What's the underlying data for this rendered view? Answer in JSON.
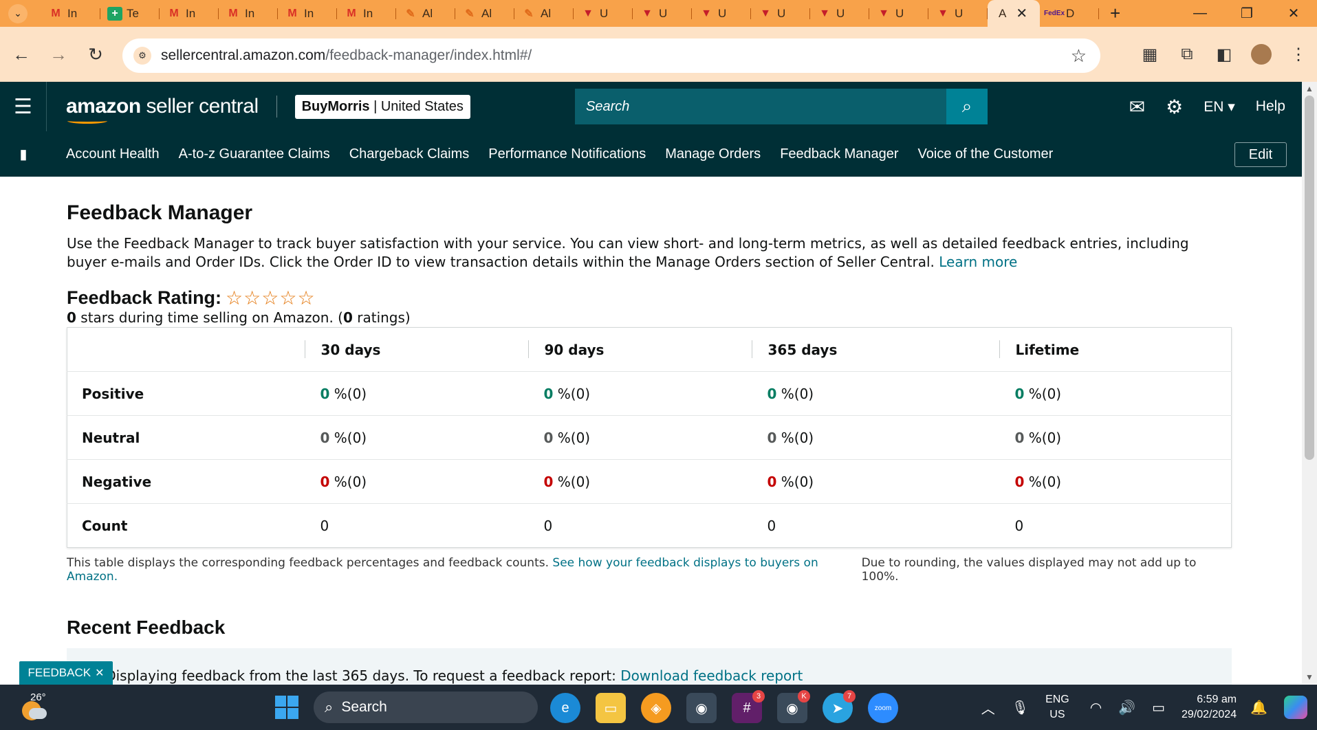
{
  "browser": {
    "tabs": [
      {
        "icon": "gmail-icon",
        "glyph": "M",
        "label": "In"
      },
      {
        "icon": "sheets-icon",
        "glyph": "+",
        "label": "Te"
      },
      {
        "icon": "gmail-icon",
        "glyph": "M",
        "label": "In"
      },
      {
        "icon": "gmail-icon",
        "glyph": "M",
        "label": "In"
      },
      {
        "icon": "gmail-icon",
        "glyph": "M",
        "label": "In"
      },
      {
        "icon": "gmail-icon",
        "glyph": "M",
        "label": "In"
      },
      {
        "icon": "pen-icon",
        "glyph": "✎",
        "label": "Al"
      },
      {
        "icon": "pen-icon",
        "glyph": "✎",
        "label": "Al"
      },
      {
        "icon": "pen-icon",
        "glyph": "✎",
        "label": "Al"
      },
      {
        "icon": "shield-v-icon",
        "glyph": "▼",
        "label": "U"
      },
      {
        "icon": "shield-v-icon",
        "glyph": "▼",
        "label": "U"
      },
      {
        "icon": "shield-v-icon",
        "glyph": "▼",
        "label": "U"
      },
      {
        "icon": "shield-v-icon",
        "glyph": "▼",
        "label": "U"
      },
      {
        "icon": "shield-v-icon",
        "glyph": "▼",
        "label": "U"
      },
      {
        "icon": "shield-v-icon",
        "glyph": "▼",
        "label": "U"
      },
      {
        "icon": "shield-v-icon",
        "glyph": "▼",
        "label": "U"
      }
    ],
    "active_tab": {
      "label": "A",
      "close": "✕"
    },
    "after_tab": {
      "icon": "fedex-icon",
      "glyph": "FedEx",
      "label": "D"
    },
    "new_tab": "+",
    "url_host": "sellercentral.amazon.com",
    "url_path": "/feedback-manager/index.html#/"
  },
  "header": {
    "logo_amazon": "amazon",
    "logo_sc": " seller central",
    "store_name": "BuyMorris",
    "store_region": "United States",
    "search_placeholder": "Search",
    "lang": "EN",
    "help": "Help"
  },
  "nav": {
    "items": [
      "Account Health",
      "A-to-z Guarantee Claims",
      "Chargeback Claims",
      "Performance Notifications",
      "Manage Orders",
      "Feedback Manager",
      "Voice of the Customer"
    ],
    "edit": "Edit"
  },
  "page": {
    "title": "Feedback Manager",
    "intro": "Use the Feedback Manager to track buyer satisfaction with your service. You can view short- and long-term metrics, as well as detailed feedback entries, including buyer e-mails and Order IDs. Click the Order ID to view transaction details within the Manage Orders section of Seller Central.",
    "learn_more": "Learn more",
    "rating_title": "Feedback Rating:",
    "stars": "☆☆☆☆☆",
    "rating_stars_value": "0",
    "rating_sub_mid": " stars during time selling on Amazon. (",
    "rating_count": "0",
    "rating_sub_end": " ratings)",
    "table": {
      "headers": [
        "30 days",
        "90 days",
        "365 days",
        "Lifetime"
      ],
      "rows": [
        {
          "label": "Positive",
          "values": [
            "0",
            "0",
            "0",
            "0"
          ],
          "suffix": " %(0)"
        },
        {
          "label": "Neutral",
          "values": [
            "0",
            "0",
            "0",
            "0"
          ],
          "suffix": " %(0)"
        },
        {
          "label": "Negative",
          "values": [
            "0",
            "0",
            "0",
            "0"
          ],
          "suffix": " %(0)"
        },
        {
          "label": "Count",
          "values": [
            "0",
            "0",
            "0",
            "0"
          ],
          "suffix": ""
        }
      ]
    },
    "footnote_left": "This table displays the corresponding feedback percentages and feedback counts.",
    "footnote_link": "See how your feedback displays to buyers on Amazon.",
    "footnote_right": "Due to rounding, the values displayed may not add up to 100%.",
    "recent_title": "Recent Feedback",
    "info_text": "Displaying feedback from the last 365 days. To request a feedback report:",
    "info_link": "Download feedback report",
    "feedback_tab": "FEEDBACK"
  },
  "taskbar": {
    "temp": "26°",
    "search": "Search",
    "lang_top": "ENG",
    "lang_bottom": "US",
    "time": "6:59 am",
    "date": "29/02/2024",
    "badges": {
      "slack": "3",
      "chrome2": "K",
      "telegram": "7"
    },
    "zoom": "zoom"
  },
  "colors": {
    "tabstrip": "#f8a24a",
    "toolbar": "#fde2c6",
    "amazon_header": "#002f36",
    "positive": "#067d62",
    "negative": "#c40000",
    "link": "#007185",
    "star": "#e47911"
  }
}
